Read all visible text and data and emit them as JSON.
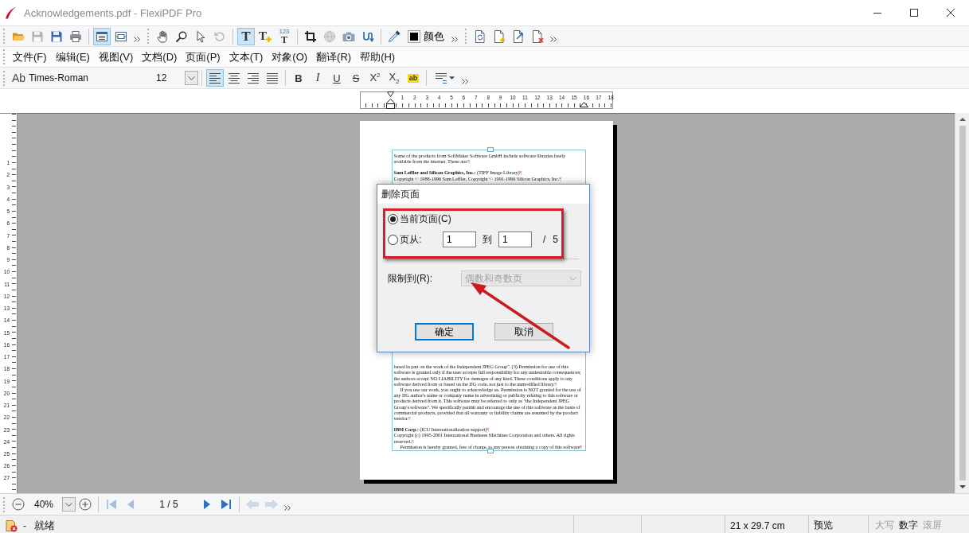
{
  "window": {
    "title": "Acknowledgements.pdf - FlexiPDF Pro"
  },
  "toolbars": [
    {
      "groups": [
        {
          "items": [
            {
              "kind": "icon",
              "selected": false,
              "disabled": false
            },
            {
              "kind": "icon",
              "selected": false,
              "disabled": true
            },
            {
              "kind": "icon",
              "selected": false,
              "disabled": false
            },
            {
              "kind": "icon",
              "selected": false,
              "disabled": false
            }
          ]
        },
        {
          "items": [
            {
              "kind": "icon",
              "selected": true,
              "disabled": false
            },
            {
              "kind": "icon",
              "selected": false,
              "disabled": false
            }
          ]
        }
      ],
      "overflow": true
    },
    {
      "groups": [
        {
          "items": [
            {
              "kind": "icon",
              "selected": false,
              "disabled": false
            },
            {
              "kind": "icon",
              "selected": false,
              "disabled": false
            },
            {
              "kind": "icon",
              "selected": false,
              "disabled": false
            },
            {
              "kind": "icon",
              "selected": false,
              "disabled": true
            }
          ]
        },
        {
          "items": [
            {
              "kind": "letter",
              "label": "T",
              "selected": true,
              "disabled": false
            },
            {
              "kind": "letter-add",
              "label": "T",
              "selected": false,
              "disabled": false
            },
            {
              "kind": "letter-number",
              "caption": "123",
              "label": "T",
              "selected": false,
              "disabled": false
            }
          ]
        },
        {
          "items": [
            {
              "kind": "icon",
              "selected": false,
              "disabled": false
            },
            {
              "kind": "icon",
              "selected": false,
              "disabled": true
            },
            {
              "kind": "icon",
              "selected": false,
              "disabled": false
            },
            {
              "kind": "icon",
              "selected": false,
              "disabled": false
            }
          ]
        },
        {
          "items": [
            {
              "kind": "icon",
              "selected": false,
              "disabled": false
            },
            {
              "kind": "color",
              "label": "颜色",
              "selected": false,
              "disabled": false
            }
          ]
        }
      ],
      "overflow": true
    },
    {
      "groups": [
        {
          "items": [
            {
              "kind": "icon",
              "selected": false,
              "disabled": false
            },
            {
              "kind": "icon",
              "selected": false,
              "disabled": false
            },
            {
              "kind": "icon",
              "selected": false,
              "disabled": false
            },
            {
              "kind": "icon",
              "selected": false,
              "disabled": false
            }
          ]
        }
      ],
      "overflow": true
    }
  ],
  "menu": [
    "文件(F)",
    "编辑(E)",
    "视图(V)",
    "文档(D)",
    "页面(P)",
    "文本(T)",
    "对象(O)",
    "翻译(R)",
    "帮助(H)"
  ],
  "format_bar": {
    "font": {
      "prefix": "Ab",
      "value": "Times-Roman"
    },
    "size": {
      "value": "12"
    },
    "alignment": [
      {
        "selected": true
      },
      {
        "selected": false
      },
      {
        "selected": false
      },
      {
        "selected": false
      }
    ],
    "styles": [
      {
        "kind": "bold",
        "label": "B"
      },
      {
        "kind": "italic",
        "label": "I"
      },
      {
        "kind": "underline",
        "label": "U"
      },
      {
        "kind": "strike",
        "label": "S"
      },
      {
        "kind": "superscript",
        "label": "X$^{2}$"
      },
      {
        "kind": "subscript",
        "label": "X$_{2}$"
      },
      {
        "kind": "highlight",
        "label": "ab"
      }
    ],
    "overflow": true
  },
  "horizontal_ruler": {
    "labels": [
      "1",
      "2",
      "3",
      "4",
      "5",
      "6",
      "7",
      "8",
      "9",
      "10",
      "11",
      "12",
      "13",
      "14",
      "15",
      "16",
      "17",
      "18"
    ]
  },
  "vertical_ruler": {
    "labels": [
      "1",
      "2",
      "3",
      "4",
      "5",
      "6",
      "7",
      "8",
      "9",
      "10",
      "11",
      "12",
      "13",
      "14",
      "15",
      "16",
      "17",
      "18",
      "19",
      "20",
      "21",
      "22",
      "23",
      "24",
      "25",
      "26",
      "27"
    ]
  },
  "page": {
    "upper": [
      {
        "paragraphs": [
          {
            "text": "Some of the products from SoftMaker Software GmbH include software libraries freely available from the internet. These are:",
            "mark": "¶",
            "indent": false
          }
        ]
      },
      {
        "paragraphs": [
          {
            "text": "**Sam Leffler and Silicon Graphics, Inc.:** (TIFF Image Library)",
            "mark": "¶",
            "indent": false
          },
          {
            "text": "Copyright © 1988-1996 Sam Leffler, Copyright © 1991-1996 Silicon Graphics, Inc.",
            "mark": "¶",
            "indent": false
          }
        ]
      }
    ],
    "lower": [
      {
        "paragraphs": [
          {
            "text": "based in part on the work of the Independent JPEG Group\". (3) Permission for use of this software is granted only if the user accepts full responsibility for any undesirable consequences; the authors accept NO LIABILITY for damages of any kind. These conditions apply to any software derived from or based on the IJG code, not just to the unmodified library.",
            "mark": "¶",
            "indent": false
          },
          {
            "text": "If you use our work, you ought to acknowledge us. Permission is NOT granted for the use of any IJG author's name or company name in advertising or publicity relating to this software or products derived from it. This software may be referred to only as \"the Independent JPEG Group's software\". We specifically permit and encourage the use of this software as the basis of commercial products, provided that all warranty or liability claims are assumed by the product vendor.",
            "mark": "¶",
            "indent": true
          }
        ]
      },
      {
        "paragraphs": [
          {
            "text": "**IBM Corp.:** (ICU Internationalization support)",
            "mark": "¶",
            "indent": false
          },
          {
            "text": "Copyright (c) 1995-2001 International Business Machines Corporation and others. All rights reserved.",
            "mark": "¶",
            "indent": false
          },
          {
            "text": "Permission is hereby granted, free of charge, to any person obtaining a copy of this software",
            "mark": "¶",
            "indent": true
          }
        ]
      }
    ]
  },
  "dialog": {
    "title": "删除页面",
    "options": [
      {
        "label": "当前页面(C)",
        "selected": true
      },
      {
        "label": "页从:",
        "selected": false,
        "range": {
          "from": "1",
          "to_label": "到",
          "to": "1",
          "separator": "/",
          "total": "5"
        }
      }
    ],
    "limit": {
      "label": "限制到(R):",
      "value": "偶数和奇数页",
      "disabled": true
    },
    "buttons": [
      {
        "label": "确定",
        "default": true
      },
      {
        "label": "取消",
        "default": false
      }
    ]
  },
  "callouts": [
    {
      "kind": "frame"
    },
    {
      "kind": "arrow"
    }
  ],
  "navigation": {
    "zoom": {
      "value": "40%"
    },
    "page": {
      "value": "1 / 5"
    },
    "buttons": [
      {
        "disabled": true
      },
      {
        "disabled": true
      },
      {
        "disabled": false
      },
      {
        "disabled": false
      }
    ],
    "history": [
      {
        "disabled": true
      },
      {
        "disabled": true
      }
    ],
    "overflow": true
  },
  "status_bar": {
    "separator": "-",
    "state": "就绪",
    "paper_size": "21 x 29.7 cm",
    "mode": "预览",
    "indicators": [
      {
        "label": "大写",
        "on": false
      },
      {
        "label": "数字",
        "on": true
      },
      {
        "label": "滚屏",
        "on": false
      }
    ]
  }
}
